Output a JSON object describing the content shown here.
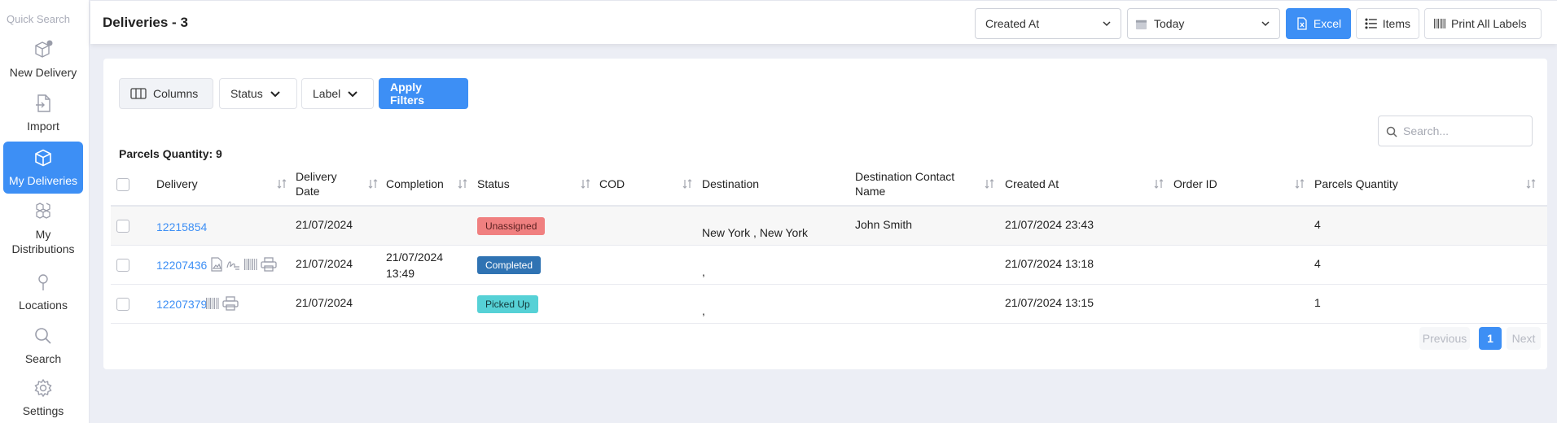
{
  "sidebar": {
    "quick_search": "Quick Search",
    "items": [
      {
        "label": "New Delivery",
        "icon": "box-plus-icon"
      },
      {
        "label": "Import",
        "icon": "file-import-icon"
      },
      {
        "label": "My Deliveries",
        "icon": "box-icon",
        "active": true
      },
      {
        "label": "My\nDistributions",
        "icon": "boxes-icon"
      },
      {
        "label": "Locations",
        "icon": "pin-icon"
      },
      {
        "label": "Search",
        "icon": "search-icon"
      },
      {
        "label": "Settings",
        "icon": "gear-icon"
      }
    ]
  },
  "header": {
    "title": "Deliveries - 3",
    "date_field_select": "Created At",
    "date_range_select": "Today",
    "excel_label": "Excel",
    "items_label": "Items",
    "print_all_label": "Print All Labels"
  },
  "filters": {
    "columns_label": "Columns",
    "status_label": "Status",
    "label_label": "Label",
    "apply_label": "Apply Filters"
  },
  "search": {
    "placeholder": "Search..."
  },
  "summary": {
    "parcels_quantity": "Parcels Quantity: 9"
  },
  "table": {
    "headers": {
      "delivery": "Delivery",
      "delivery_date": "Delivery Date",
      "completion": "Completion",
      "status": "Status",
      "cod": "COD",
      "destination": "Destination",
      "destination_contact": "Destination Contact Name",
      "created_at": "Created At",
      "order_id": "Order ID",
      "parcels_quantity": "Parcels Quantity"
    },
    "rows": [
      {
        "delivery": "12215854",
        "delivery_date": "21/07/2024",
        "completion": "",
        "status": "Unassigned",
        "cod": "",
        "destination": "New York , New York",
        "contact": "John Smith",
        "created_at": "21/07/2024 23:43",
        "order_id": "",
        "parcels": "4"
      },
      {
        "delivery": "12207436",
        "delivery_date": "21/07/2024",
        "completion": "21/07/2024 13:49",
        "status": "Completed",
        "cod": "",
        "destination": ",",
        "contact": "",
        "created_at": "21/07/2024 13:18",
        "order_id": "",
        "parcels": "4"
      },
      {
        "delivery": "12207379",
        "delivery_date": "21/07/2024",
        "completion": "",
        "status": "Picked Up",
        "cod": "",
        "destination": ",",
        "contact": "",
        "created_at": "21/07/2024 13:15",
        "order_id": "",
        "parcels": "1"
      }
    ]
  },
  "pagination": {
    "previous": "Previous",
    "current": "1",
    "next": "Next"
  },
  "colors": {
    "accent": "#3d8ff5",
    "unassigned": "#f08080",
    "completed": "#2f73b3",
    "picked_up": "#56d1d6"
  }
}
